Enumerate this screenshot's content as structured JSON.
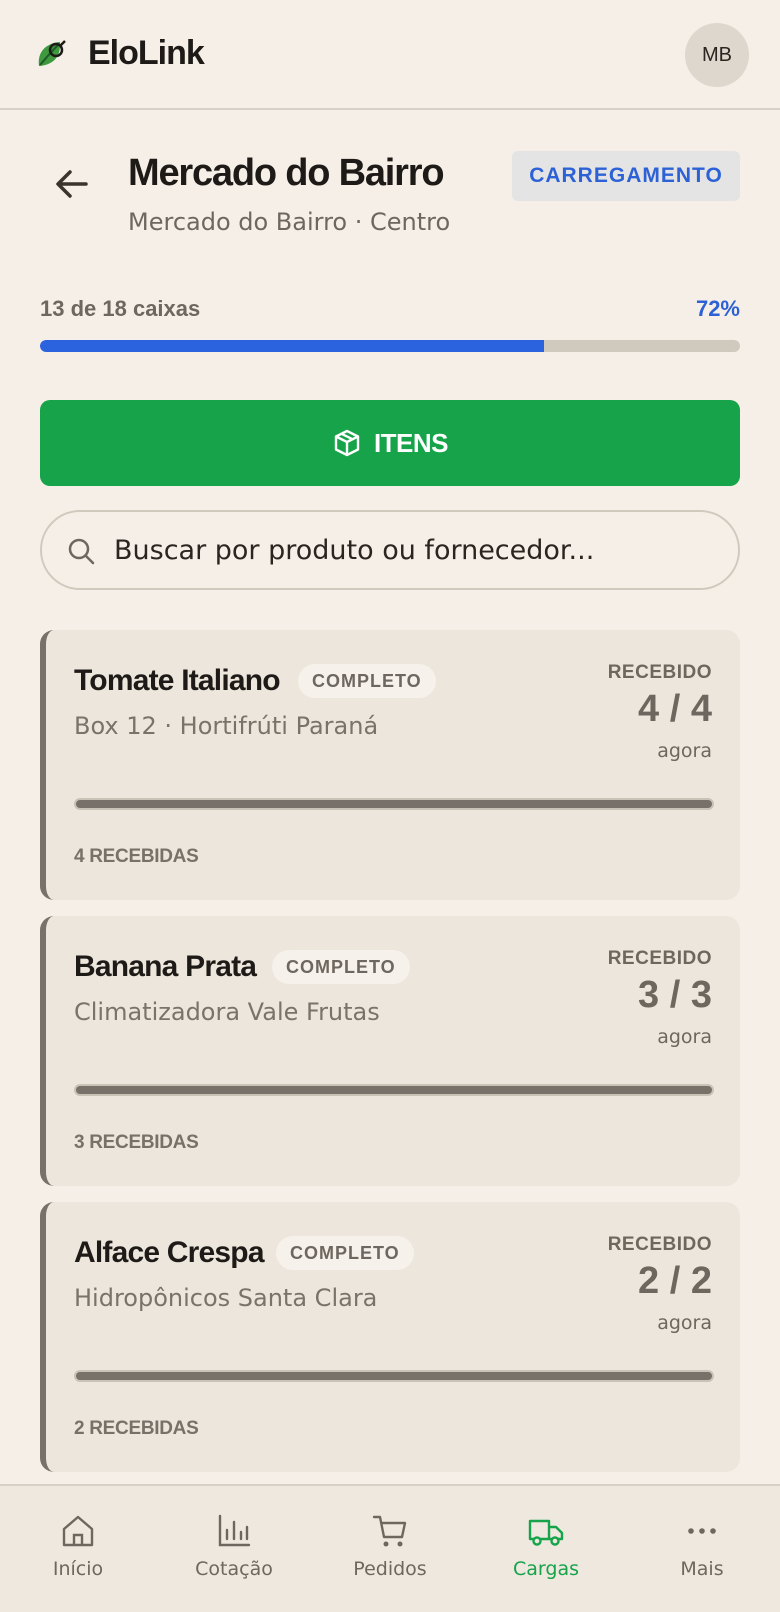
{
  "app": {
    "title": "EloLink",
    "avatar_initials": "MB"
  },
  "page": {
    "title": "Mercado do Bairro",
    "subtitle": "Mercado do Bairro · Centro",
    "status": "CARREGAMENTO"
  },
  "progress": {
    "label": "13 de 18 caixas",
    "percent_text": "72%",
    "value": 0.72
  },
  "actions": {
    "items_button": "ITENS"
  },
  "search": {
    "placeholder": "Buscar por produto ou fornecedor..."
  },
  "items": [
    {
      "name": "Tomate Italiano",
      "badge": "COMPLETO",
      "sub": "Box 12 · Hortifrúti Paraná",
      "recv_label": "RECEBIDO",
      "count": "4 / 4",
      "time": "agora",
      "footer": "4 RECEBIDAS"
    },
    {
      "name": "Banana Prata",
      "badge": "COMPLETO",
      "sub": "Climatizadora Vale Frutas",
      "recv_label": "RECEBIDO",
      "count": "3 / 3",
      "time": "agora",
      "footer": "3 RECEBIDAS"
    },
    {
      "name": "Alface Crespa",
      "badge": "COMPLETO",
      "sub": "Hidropônicos Santa Clara",
      "recv_label": "RECEBIDO",
      "count": "2 / 2",
      "time": "agora",
      "footer": "2 RECEBIDAS"
    }
  ],
  "nav": [
    {
      "label": "Início",
      "icon": "home-icon"
    },
    {
      "label": "Cotação",
      "icon": "chart-icon"
    },
    {
      "label": "Pedidos",
      "icon": "cart-icon"
    },
    {
      "label": "Cargas",
      "icon": "truck-icon",
      "active": true
    },
    {
      "label": "Mais",
      "icon": "more-icon"
    }
  ],
  "colors": {
    "accent": "#16a34a",
    "info": "#2d62d6",
    "progress": "#2b62de"
  }
}
